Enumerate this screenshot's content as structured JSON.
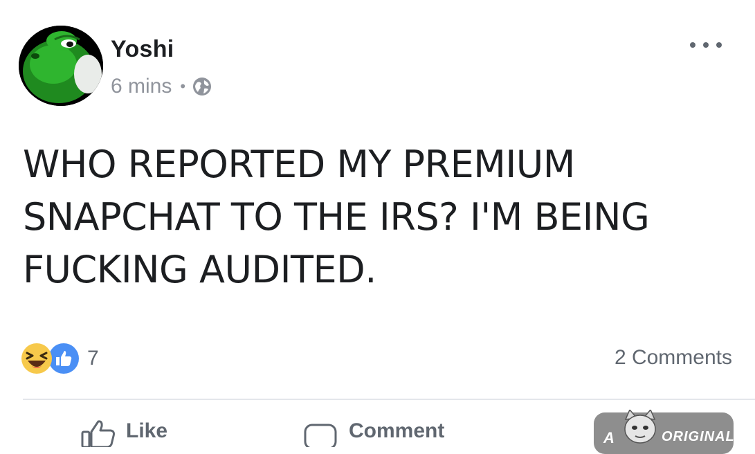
{
  "post": {
    "author": "Yoshi",
    "timestamp": "6 mins",
    "separator": "•",
    "privacy_icon": "globe-icon",
    "more_icon": "more-options-icon",
    "text_lines": [
      "WHO REPORTED MY PREMIUM",
      "SNAPCHAT TO THE IRS? I'M BEING",
      "FUCKING AUDITED."
    ]
  },
  "reactions": {
    "icons": [
      "haha-reaction-icon",
      "like-reaction-icon"
    ],
    "count": "7",
    "comments": "2 Comments"
  },
  "actions": {
    "like_label": "Like",
    "comment_label": "Comment"
  },
  "watermark": {
    "prefix": "A",
    "suffix": "ORIGINAL"
  },
  "colors": {
    "like_blue": "#4a8ff5",
    "haha_yellow": "#f7c94b",
    "meta_gray": "#90949c",
    "text_dark": "#1c1e21"
  }
}
